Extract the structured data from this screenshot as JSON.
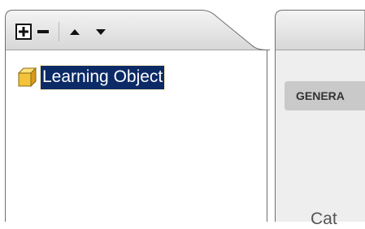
{
  "tree_panel": {
    "toolbar": {
      "add_icon": "plus-icon",
      "remove_icon": "minus-icon",
      "move_up_icon": "triangle-up-icon",
      "move_down_icon": "triangle-down-icon"
    },
    "root_node": {
      "label": "Learning Object",
      "icon": "cube-icon"
    }
  },
  "right_panel": {
    "tab_label": "GENERA",
    "clipped_text": "Cat"
  },
  "colors": {
    "selection_bg": "#0b2a66",
    "panel_border": "#6f6f6f",
    "cube_icon": "#f3c339"
  }
}
